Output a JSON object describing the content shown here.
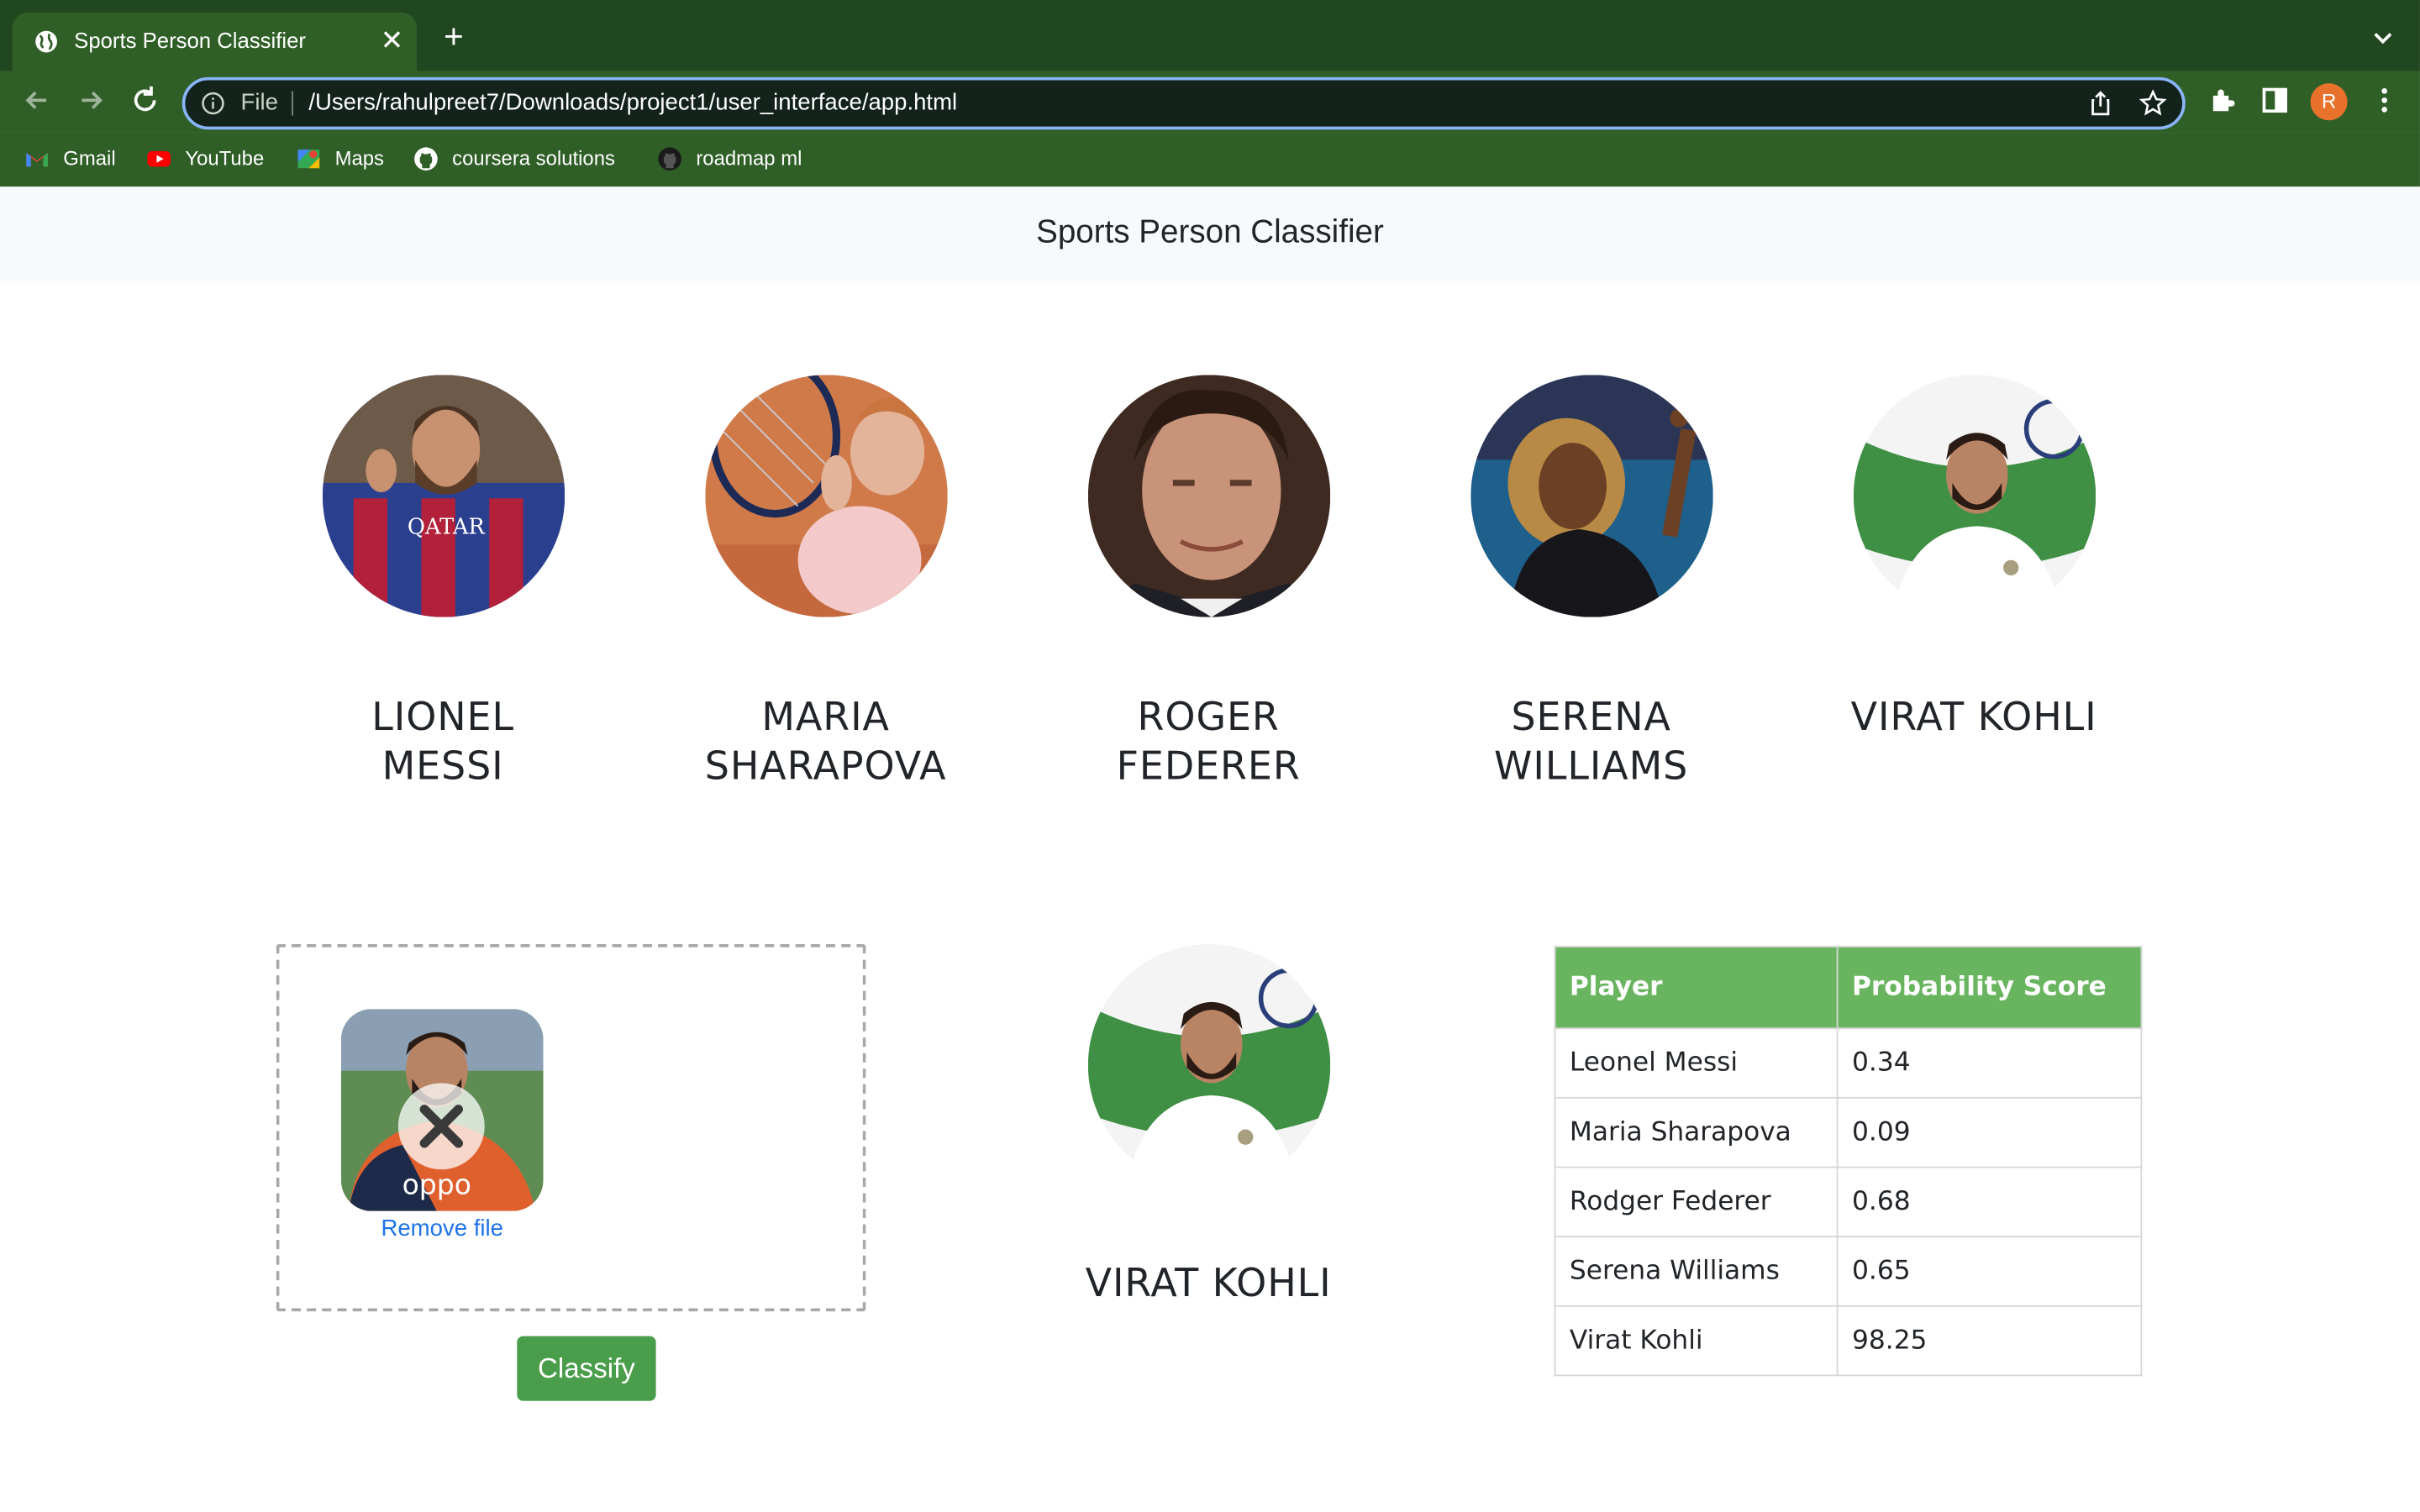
{
  "browser": {
    "tab_title": "Sports Person Classifier",
    "address_scheme": "File",
    "address_url": "/Users/rahulpreet7/Downloads/project1/user_interface/app.html",
    "profile_initial": "R",
    "bookmarks": [
      {
        "label": "Gmail",
        "icon": "gmail-icon"
      },
      {
        "label": "YouTube",
        "icon": "youtube-icon"
      },
      {
        "label": "Maps",
        "icon": "maps-icon"
      },
      {
        "label": "coursera solutions",
        "icon": "github-icon"
      },
      {
        "label": "roadmap ml",
        "icon": "github-icon"
      }
    ]
  },
  "header": {
    "title": "Sports Person Classifier"
  },
  "players": [
    {
      "name_line1": "LIONEL",
      "name_line2": "MESSI"
    },
    {
      "name_line1": "MARIA",
      "name_line2": "SHARAPOVA"
    },
    {
      "name_line1": "ROGER",
      "name_line2": "FEDERER"
    },
    {
      "name_line1": "SERENA",
      "name_line2": "WILLIAMS"
    },
    {
      "name_line1": "VIRAT KOHLI",
      "name_line2": ""
    }
  ],
  "upload": {
    "remove_label": "Remove file",
    "classify_label": "Classify"
  },
  "result": {
    "name": "VIRAT KOHLI"
  },
  "table": {
    "headers": [
      "Player",
      "Probability Score"
    ],
    "rows": [
      [
        "Leonel Messi",
        "0.34"
      ],
      [
        "Maria Sharapova",
        "0.09"
      ],
      [
        "Rodger Federer",
        "0.68"
      ],
      [
        "Serena Williams",
        "0.65"
      ],
      [
        "Virat Kohli",
        "98.25"
      ]
    ]
  },
  "colors": {
    "browser_frame": "#2f5e27",
    "table_header": "#69b45f",
    "classify_button": "#4a9d4a",
    "link": "#1e73e8"
  }
}
